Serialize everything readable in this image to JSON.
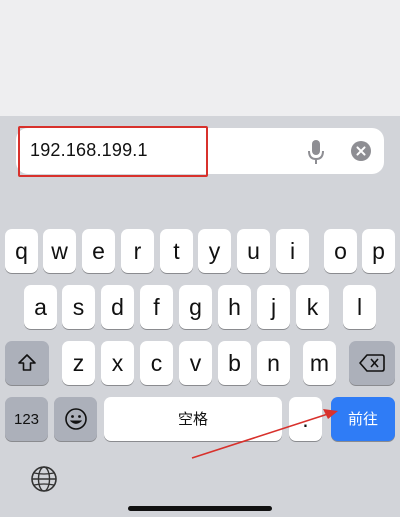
{
  "address_bar": {
    "url_value": "192.168.199.1"
  },
  "icons": {
    "mic": "microphone-icon",
    "clear": "clear-icon",
    "shift": "shift-icon",
    "delete": "delete-icon",
    "emoji": "emoji-icon",
    "globe": "globe-icon"
  },
  "keyboard": {
    "row1": [
      "q",
      "w",
      "e",
      "r",
      "t",
      "y",
      "u",
      "i",
      "o",
      "p"
    ],
    "row2": [
      "a",
      "s",
      "d",
      "f",
      "g",
      "h",
      "j",
      "k",
      "l"
    ],
    "row3": [
      "z",
      "x",
      "c",
      "v",
      "b",
      "n",
      "m"
    ],
    "numbers_key": "123",
    "space_key": "空格",
    "period_key": ".",
    "go_key": "前往"
  },
  "annotation": {
    "highlight_color": "#d8312c",
    "arrow_color": "#d8312c"
  },
  "colors": {
    "go_key_bg": "#2f7cf6",
    "keyboard_bg": "#d2d4d9"
  }
}
